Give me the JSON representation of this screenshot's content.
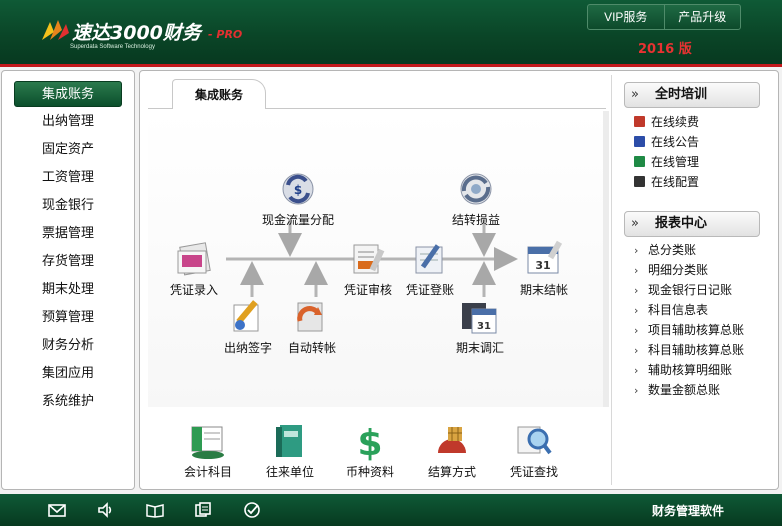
{
  "header": {
    "brand": "速达3000财务",
    "brand_suffix": "- PRO",
    "brand_sub": "Superdata Software Technology",
    "vip_label": "VIP服务",
    "upgrade_label": "产品升级",
    "version": "2016 版"
  },
  "sidebar": {
    "items": [
      {
        "label": "集成账务",
        "active": true
      },
      {
        "label": "出纳管理"
      },
      {
        "label": "固定资产"
      },
      {
        "label": "工资管理"
      },
      {
        "label": "现金银行"
      },
      {
        "label": "票据管理"
      },
      {
        "label": "存货管理"
      },
      {
        "label": "期末处理"
      },
      {
        "label": "预算管理"
      },
      {
        "label": "财务分析"
      },
      {
        "label": "集团应用"
      },
      {
        "label": "系统维护"
      }
    ]
  },
  "main": {
    "tab_label": "集成账务",
    "flow": {
      "cashflow": "现金流量分配",
      "transfer_pl": "结转损益",
      "voucher_entry": "凭证录入",
      "voucher_review": "凭证审核",
      "voucher_post": "凭证登账",
      "period_close": "期末结帐",
      "cashier_sign": "出纳签字",
      "auto_transfer": "自动转帐",
      "period_adjust": "期末调汇"
    },
    "shortcuts": [
      {
        "label": "会计科目",
        "icon": "ledger-icon"
      },
      {
        "label": "往来单位",
        "icon": "book-icon"
      },
      {
        "label": "币种资料",
        "icon": "currency-icon"
      },
      {
        "label": "结算方式",
        "icon": "coins-icon"
      },
      {
        "label": "凭证查找",
        "icon": "magnifier-icon"
      }
    ]
  },
  "training": {
    "title": "全时培训",
    "items": [
      {
        "label": "在线续费",
        "color": "#c0392b"
      },
      {
        "label": "在线公告",
        "color": "#2c4da8"
      },
      {
        "label": "在线管理",
        "color": "#1f8a45"
      },
      {
        "label": "在线配置",
        "color": "#333333"
      }
    ]
  },
  "reports": {
    "title": "报表中心",
    "items": [
      "总分类账",
      "明细分类账",
      "现金银行日记账",
      "科目信息表",
      "项目辅助核算总账",
      "科目辅助核算总账",
      "辅助核算明细账",
      "数量金额总账"
    ]
  },
  "footer": {
    "brand": "财务管理软件",
    "icons": [
      "mail-icon",
      "speaker-icon",
      "book-open-icon",
      "windows-icon",
      "check-circle-icon"
    ]
  },
  "theme": {
    "primary_green": "#0a4527",
    "accent_red": "#c4181b"
  }
}
